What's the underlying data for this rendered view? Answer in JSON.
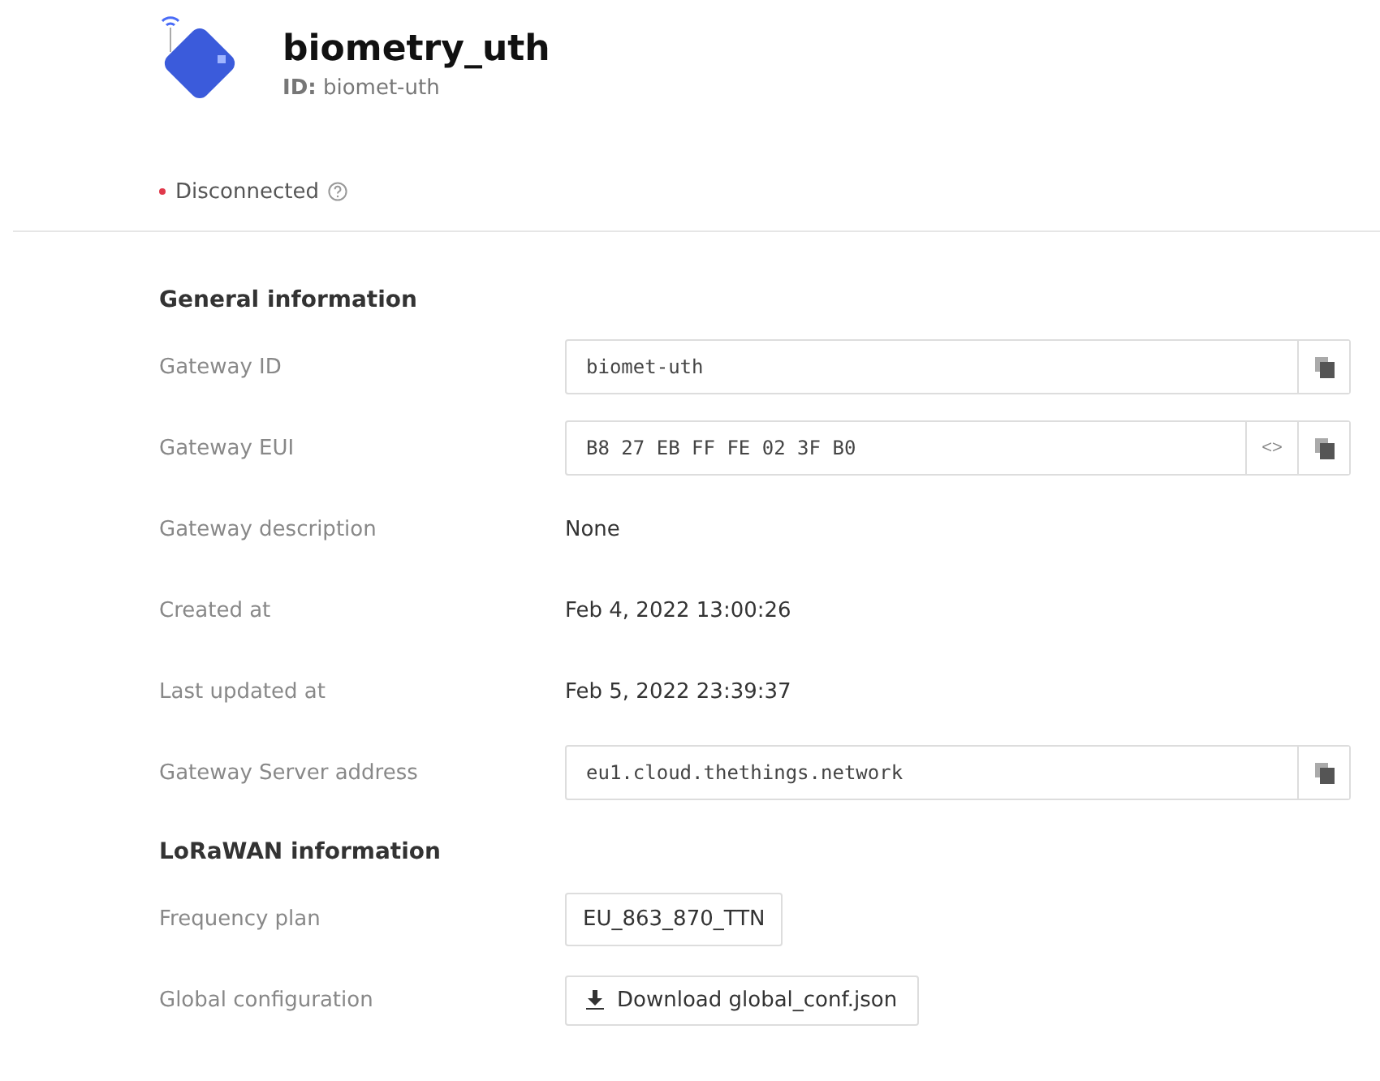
{
  "header": {
    "title": "biometry_uth",
    "id_label": "ID:",
    "id_value": "biomet-uth"
  },
  "status": {
    "label": "Disconnected",
    "connected": false
  },
  "sections": [
    {
      "title": "General information",
      "rows": [
        {
          "label": "Gateway ID",
          "kind": "copy",
          "value": "biomet-uth",
          "hex_toggle": false
        },
        {
          "label": "Gateway EUI",
          "kind": "copy",
          "value": "B8 27 EB FF FE 02 3F B0",
          "hex_toggle": true,
          "hex_symbol": "<>"
        },
        {
          "label": "Gateway description",
          "kind": "text",
          "value": "None"
        },
        {
          "label": "Created at",
          "kind": "text",
          "value": "Feb 4, 2022 13:00:26"
        },
        {
          "label": "Last updated at",
          "kind": "text",
          "value": "Feb 5, 2022 23:39:37"
        },
        {
          "label": "Gateway Server address",
          "kind": "copy",
          "value": "eu1.cloud.thethings.network",
          "hex_toggle": false
        }
      ]
    },
    {
      "title": "LoRaWAN information",
      "rows": [
        {
          "label": "Frequency plan",
          "kind": "tag",
          "value": "EU_863_870_TTN"
        },
        {
          "label": "Global configuration",
          "kind": "download",
          "value": "Download global_conf.json"
        }
      ]
    }
  ]
}
